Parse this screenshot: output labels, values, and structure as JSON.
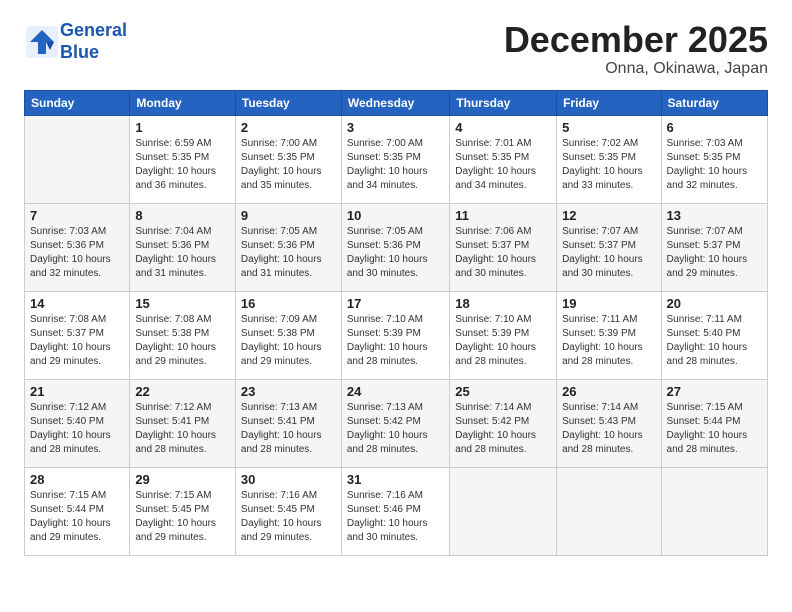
{
  "header": {
    "logo_line1": "General",
    "logo_line2": "Blue",
    "title": "December 2025",
    "subtitle": "Onna, Okinawa, Japan"
  },
  "weekdays": [
    "Sunday",
    "Monday",
    "Tuesday",
    "Wednesday",
    "Thursday",
    "Friday",
    "Saturday"
  ],
  "weeks": [
    [
      {
        "day": "",
        "info": ""
      },
      {
        "day": "1",
        "info": "Sunrise: 6:59 AM\nSunset: 5:35 PM\nDaylight: 10 hours\nand 36 minutes."
      },
      {
        "day": "2",
        "info": "Sunrise: 7:00 AM\nSunset: 5:35 PM\nDaylight: 10 hours\nand 35 minutes."
      },
      {
        "day": "3",
        "info": "Sunrise: 7:00 AM\nSunset: 5:35 PM\nDaylight: 10 hours\nand 34 minutes."
      },
      {
        "day": "4",
        "info": "Sunrise: 7:01 AM\nSunset: 5:35 PM\nDaylight: 10 hours\nand 34 minutes."
      },
      {
        "day": "5",
        "info": "Sunrise: 7:02 AM\nSunset: 5:35 PM\nDaylight: 10 hours\nand 33 minutes."
      },
      {
        "day": "6",
        "info": "Sunrise: 7:03 AM\nSunset: 5:35 PM\nDaylight: 10 hours\nand 32 minutes."
      }
    ],
    [
      {
        "day": "7",
        "info": "Sunrise: 7:03 AM\nSunset: 5:36 PM\nDaylight: 10 hours\nand 32 minutes."
      },
      {
        "day": "8",
        "info": "Sunrise: 7:04 AM\nSunset: 5:36 PM\nDaylight: 10 hours\nand 31 minutes."
      },
      {
        "day": "9",
        "info": "Sunrise: 7:05 AM\nSunset: 5:36 PM\nDaylight: 10 hours\nand 31 minutes."
      },
      {
        "day": "10",
        "info": "Sunrise: 7:05 AM\nSunset: 5:36 PM\nDaylight: 10 hours\nand 30 minutes."
      },
      {
        "day": "11",
        "info": "Sunrise: 7:06 AM\nSunset: 5:37 PM\nDaylight: 10 hours\nand 30 minutes."
      },
      {
        "day": "12",
        "info": "Sunrise: 7:07 AM\nSunset: 5:37 PM\nDaylight: 10 hours\nand 30 minutes."
      },
      {
        "day": "13",
        "info": "Sunrise: 7:07 AM\nSunset: 5:37 PM\nDaylight: 10 hours\nand 29 minutes."
      }
    ],
    [
      {
        "day": "14",
        "info": "Sunrise: 7:08 AM\nSunset: 5:37 PM\nDaylight: 10 hours\nand 29 minutes."
      },
      {
        "day": "15",
        "info": "Sunrise: 7:08 AM\nSunset: 5:38 PM\nDaylight: 10 hours\nand 29 minutes."
      },
      {
        "day": "16",
        "info": "Sunrise: 7:09 AM\nSunset: 5:38 PM\nDaylight: 10 hours\nand 29 minutes."
      },
      {
        "day": "17",
        "info": "Sunrise: 7:10 AM\nSunset: 5:39 PM\nDaylight: 10 hours\nand 28 minutes."
      },
      {
        "day": "18",
        "info": "Sunrise: 7:10 AM\nSunset: 5:39 PM\nDaylight: 10 hours\nand 28 minutes."
      },
      {
        "day": "19",
        "info": "Sunrise: 7:11 AM\nSunset: 5:39 PM\nDaylight: 10 hours\nand 28 minutes."
      },
      {
        "day": "20",
        "info": "Sunrise: 7:11 AM\nSunset: 5:40 PM\nDaylight: 10 hours\nand 28 minutes."
      }
    ],
    [
      {
        "day": "21",
        "info": "Sunrise: 7:12 AM\nSunset: 5:40 PM\nDaylight: 10 hours\nand 28 minutes."
      },
      {
        "day": "22",
        "info": "Sunrise: 7:12 AM\nSunset: 5:41 PM\nDaylight: 10 hours\nand 28 minutes."
      },
      {
        "day": "23",
        "info": "Sunrise: 7:13 AM\nSunset: 5:41 PM\nDaylight: 10 hours\nand 28 minutes."
      },
      {
        "day": "24",
        "info": "Sunrise: 7:13 AM\nSunset: 5:42 PM\nDaylight: 10 hours\nand 28 minutes."
      },
      {
        "day": "25",
        "info": "Sunrise: 7:14 AM\nSunset: 5:42 PM\nDaylight: 10 hours\nand 28 minutes."
      },
      {
        "day": "26",
        "info": "Sunrise: 7:14 AM\nSunset: 5:43 PM\nDaylight: 10 hours\nand 28 minutes."
      },
      {
        "day": "27",
        "info": "Sunrise: 7:15 AM\nSunset: 5:44 PM\nDaylight: 10 hours\nand 28 minutes."
      }
    ],
    [
      {
        "day": "28",
        "info": "Sunrise: 7:15 AM\nSunset: 5:44 PM\nDaylight: 10 hours\nand 29 minutes."
      },
      {
        "day": "29",
        "info": "Sunrise: 7:15 AM\nSunset: 5:45 PM\nDaylight: 10 hours\nand 29 minutes."
      },
      {
        "day": "30",
        "info": "Sunrise: 7:16 AM\nSunset: 5:45 PM\nDaylight: 10 hours\nand 29 minutes."
      },
      {
        "day": "31",
        "info": "Sunrise: 7:16 AM\nSunset: 5:46 PM\nDaylight: 10 hours\nand 30 minutes."
      },
      {
        "day": "",
        "info": ""
      },
      {
        "day": "",
        "info": ""
      },
      {
        "day": "",
        "info": ""
      }
    ]
  ]
}
